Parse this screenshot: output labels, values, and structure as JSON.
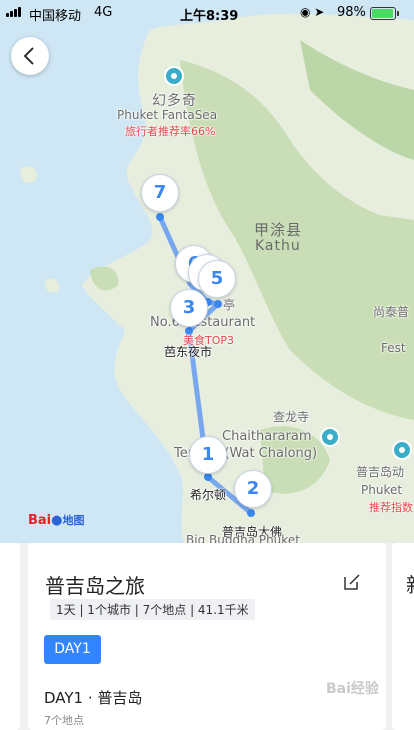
{
  "status_bar": {
    "carrier": "中国移动",
    "network": "4G",
    "time": "上午8:39",
    "battery_percent": "98%",
    "battery_level": 0.98
  },
  "map": {
    "labels": {
      "fantasea_cn": "幻多奇",
      "fantasea_en": "Phuket FantaSea",
      "fantasea_rating": "旅行者推荐率66%",
      "kathu_cn": "甲涂县",
      "kathu_en": "Kathu",
      "restaurant_en": "No.6 Restaurant",
      "food_top": "美食TOP3",
      "night_market": "芭东夜市",
      "chalong_cn": "查龙寺",
      "chalong_en": "Chaithararam",
      "temple_prefix": "Temple (Wat Chalong)",
      "hilton": "希尔顿",
      "big_buddha_cn": "普吉岛大佛",
      "big_buddha_en": "Big Buddha Phuket",
      "phuket_right_cn": "普吉岛动",
      "phuket_right_en": "Phuket",
      "phuket_right_rec": "推荐指数",
      "right_top_cn": "尚泰普",
      "right_top_en": "Fest",
      "jiaoting": "亭"
    },
    "markers": [
      "7",
      "6",
      "5",
      "3",
      "1",
      "2"
    ],
    "logo": {
      "brand": "Bai",
      "suffix": "地图"
    }
  },
  "trip": {
    "title": "普吉岛之旅",
    "summary": "1天 | 1个城市 | 7个地点 | 41.1千米",
    "day_tab": "DAY1",
    "day_title": "DAY1 · 普吉岛",
    "day_subtitle": "7个地点",
    "next_card_peek": "新"
  },
  "watermark": "Bai经验",
  "colors": {
    "accent": "#3385ff",
    "marker_text": "#3a87f0",
    "route": "#6a9ef0",
    "highlight": "#e8444a"
  }
}
